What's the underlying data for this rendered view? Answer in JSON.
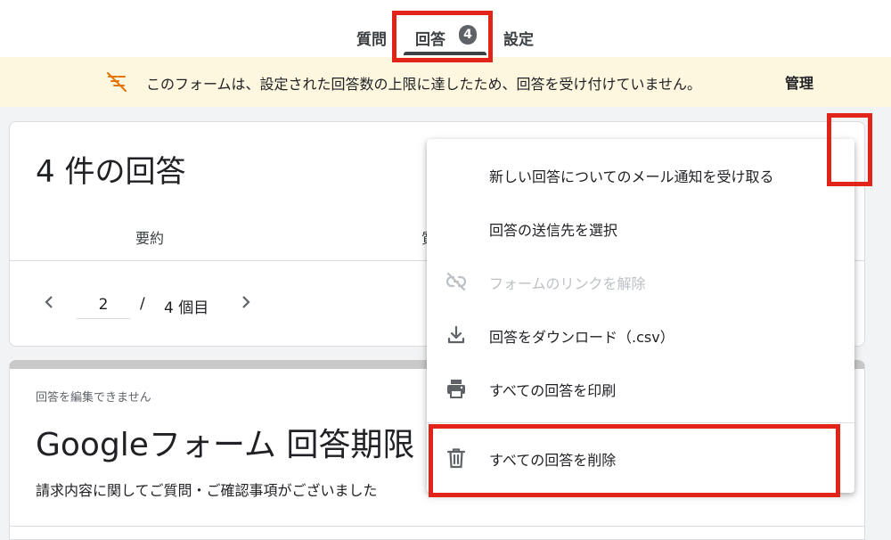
{
  "tabs": {
    "questions": "質問",
    "responses": "回答",
    "responses_badge": "4",
    "settings": "設定"
  },
  "banner": {
    "icon": "notifications-off-icon",
    "text": "このフォームは、設定された回答数の上限に達したため、回答を受け付けていません。",
    "manage": "管理"
  },
  "summary": {
    "title": "4 件の回答",
    "subtabs": [
      "要約",
      "質"
    ],
    "pager": {
      "current": "2",
      "separator": "/",
      "total": "4 個目"
    }
  },
  "response": {
    "readonly_note": "回答を編集できません",
    "form_title": "Googleフォーム 回答期限",
    "description": "請求内容に関してご質問・ご確認事項がございました"
  },
  "menu": {
    "items": [
      {
        "label": "新しい回答についてのメール通知を受け取る",
        "icon": "",
        "enabled": true
      },
      {
        "label": "回答の送信先を選択",
        "icon": "",
        "enabled": true
      },
      {
        "label": "フォームのリンクを解除",
        "icon": "link-off-icon",
        "enabled": false
      },
      {
        "label": "回答をダウンロード（.csv）",
        "icon": "download-icon",
        "enabled": true
      },
      {
        "label": "すべての回答を印刷",
        "icon": "print-icon",
        "enabled": true
      },
      {
        "label": "すべての回答を削除",
        "icon": "trash-icon",
        "enabled": true
      }
    ]
  },
  "colors": {
    "highlight": "#e2231a",
    "banner_bg": "#fef7e0",
    "banner_icon": "#e37400",
    "text_primary": "#202124",
    "disabled": "#bdc1c6"
  }
}
